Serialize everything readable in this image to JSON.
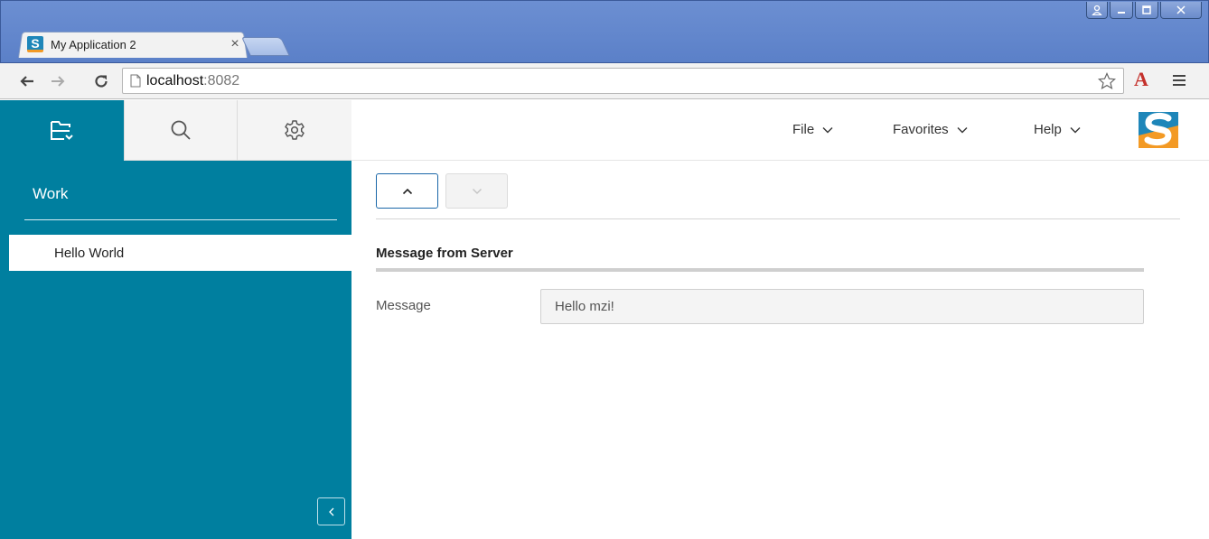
{
  "browser": {
    "tab_title": "My Application 2",
    "tab_close": "×",
    "address_host": "localhost",
    "address_port": ":8082",
    "favicon_letter": "S",
    "extension_letter": "A"
  },
  "sidebar": {
    "tabs": [
      {
        "icon": "outline-icon",
        "active": true
      },
      {
        "icon": "search-icon",
        "active": false
      },
      {
        "icon": "gear-icon",
        "active": false
      }
    ],
    "section_title": "Work",
    "items": [
      {
        "label": "Hello World",
        "selected": true
      }
    ]
  },
  "header": {
    "menus": [
      {
        "label": "File"
      },
      {
        "label": "Favorites"
      },
      {
        "label": "Help"
      }
    ]
  },
  "content": {
    "group_title": "Message from Server",
    "field_label": "Message",
    "field_value": "Hello mzi!"
  },
  "colors": {
    "sidebar_bg": "#007f9f",
    "accent_blue": "#1a67a8",
    "logo_blue": "#1e86b9",
    "logo_orange": "#f39a25"
  }
}
